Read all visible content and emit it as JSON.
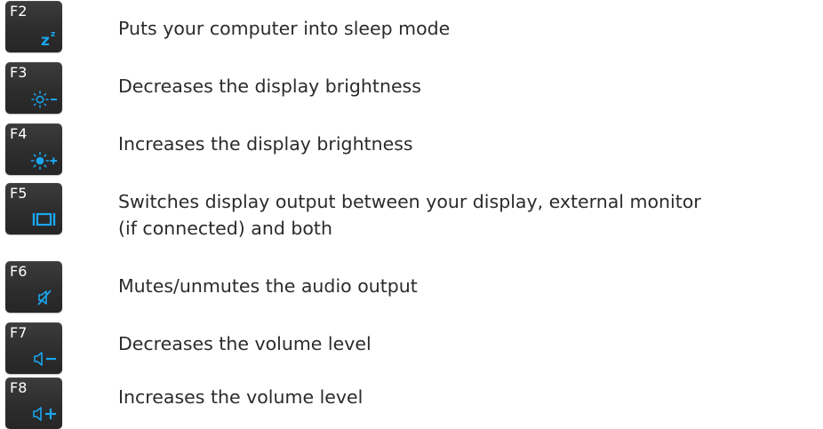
{
  "accent_color": "#1aa6ef",
  "keys": [
    {
      "label": "F2",
      "icon": "sleep-icon",
      "description": "Puts your computer into sleep mode"
    },
    {
      "label": "F3",
      "icon": "brightness-down-icon",
      "description": "Decreases the display brightness"
    },
    {
      "label": "F4",
      "icon": "brightness-up-icon",
      "description": "Increases the display brightness"
    },
    {
      "label": "F5",
      "icon": "display-switch-icon",
      "description_lines": [
        "Switches display output between your display, external monitor",
        "(if connected) and both"
      ]
    },
    {
      "label": "F6",
      "icon": "mute-icon",
      "description": "Mutes/unmutes the audio output"
    },
    {
      "label": "F7",
      "icon": "volume-down-icon",
      "description": "Decreases the volume level"
    },
    {
      "label": "F8",
      "icon": "volume-up-icon",
      "description": "Increases the volume level"
    }
  ]
}
